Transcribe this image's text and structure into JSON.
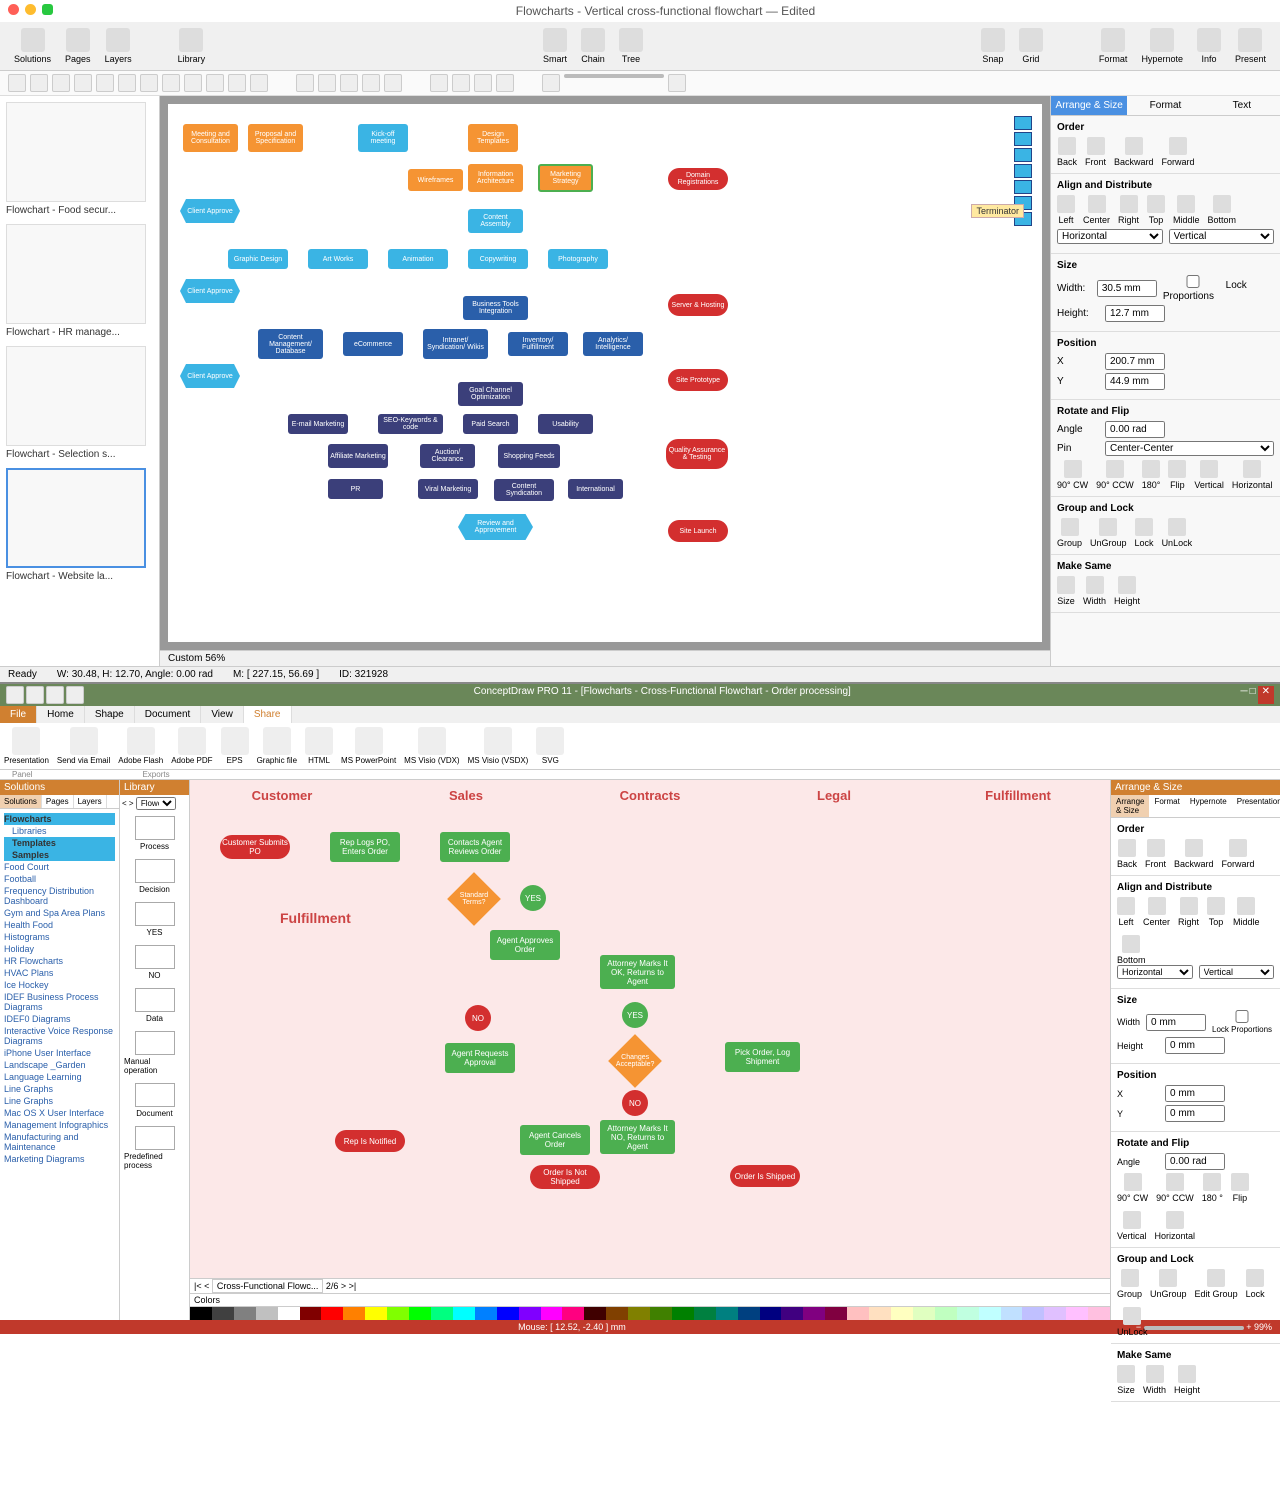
{
  "app1": {
    "title": "Flowcharts - Vertical cross-functional flowchart — Edited",
    "toolbar": {
      "solutions": "Solutions",
      "pages": "Pages",
      "layers": "Layers",
      "library": "Library",
      "smart": "Smart",
      "chain": "Chain",
      "tree": "Tree",
      "snap": "Snap",
      "grid": "Grid",
      "format": "Format",
      "hypernote": "Hypernote",
      "info": "Info",
      "present": "Present"
    },
    "thumbs": [
      {
        "label": "Flowchart - Food secur..."
      },
      {
        "label": "Flowchart - HR manage..."
      },
      {
        "label": "Flowchart - Selection s..."
      },
      {
        "label": "Flowchart - Website la..."
      }
    ],
    "tooltip": "Terminator",
    "zoom": "Custom 56%",
    "statusW": "W: 30.48, H: 12.70, Angle: 0.00 rad",
    "statusM": "M: [ 227.15, 56.69 ]",
    "statusID": "ID: 321928",
    "statusReady": "Ready",
    "shapes": {
      "meeting": "Meeting and Consultation",
      "proposal": "Proposal and Specification",
      "kickoff": "Kick-off meeting",
      "design": "Design Templates",
      "wireframes": "Wireframes",
      "info": "Information Architecture",
      "marketing": "Marketing Strategy",
      "domain": "Domain Registrations",
      "approve": "Client Approve",
      "assembly": "Content Assembly",
      "graphic": "Graphic Design",
      "art": "Art Works",
      "anim": "Animation",
      "copy": "Copywriting",
      "photo": "Photography",
      "btools": "Business Tools Integration",
      "server": "Server & Hosting",
      "cms": "Content Management/ Database",
      "ecom": "eCommerce",
      "intranet": "Intranet/ Syndication/ Wikis",
      "inv": "Inventory/ Fulfillment",
      "analytics": "Analytics/ Intelligence",
      "siteproto": "Site Prototype",
      "goal": "Goal Channel Optimization",
      "email": "E-mail Marketing",
      "seo": "SEO-Keywords & code",
      "paid": "Paid Search",
      "usab": "Usability",
      "aff": "Affiliate Marketing",
      "auction": "Auction/ Clearance",
      "shop": "Shopping Feeds",
      "qa": "Quality Assurance & Testing",
      "pr": "PR",
      "viral": "Viral Marketing",
      "synd": "Content Syndication",
      "intl": "International",
      "review": "Review and Approvement",
      "launch": "Site Launch"
    },
    "inspector": {
      "tabs": {
        "arr": "Arrange & Size",
        "fmt": "Format",
        "txt": "Text"
      },
      "order": {
        "h": "Order",
        "back": "Back",
        "front": "Front",
        "backward": "Backward",
        "forward": "Forward"
      },
      "align": {
        "h": "Align and Distribute",
        "left": "Left",
        "center": "Center",
        "right": "Right",
        "top": "Top",
        "middle": "Middle",
        "bottom": "Bottom",
        "horiz": "Horizontal",
        "vert": "Vertical"
      },
      "size": {
        "h": "Size",
        "wl": "Width:",
        "w": "30.5 mm",
        "hl": "Height:",
        "hv": "12.7 mm",
        "lock": "Lock Proportions"
      },
      "pos": {
        "h": "Position",
        "xl": "X",
        "x": "200.7 mm",
        "yl": "Y",
        "y": "44.9 mm"
      },
      "rot": {
        "h": "Rotate and Flip",
        "al": "Angle",
        "a": "0.00 rad",
        "pl": "Pin",
        "p": "Center-Center",
        "cw": "90° CW",
        "ccw": "90° CCW",
        "d180": "180°",
        "flip": "Flip",
        "v": "Vertical",
        "ho": "Horizontal"
      },
      "grp": {
        "h": "Group and Lock",
        "g": "Group",
        "ug": "UnGroup",
        "l": "Lock",
        "ul": "UnLock"
      },
      "same": {
        "h": "Make Same",
        "s": "Size",
        "w": "Width",
        "ht": "Height"
      }
    }
  },
  "app2": {
    "title": "ConceptDraw PRO 11 - [Flowcharts - Cross-Functional Flowchart - Order processing]",
    "menu": {
      "file": "File",
      "home": "Home",
      "shape": "Shape",
      "document": "Document",
      "view": "View",
      "share": "Share"
    },
    "ribbon": {
      "pres": "Presentation",
      "email": "Send via Email",
      "flash": "Adobe Flash",
      "pdf": "Adobe PDF",
      "eps": "EPS",
      "gfile": "Graphic file",
      "html": "HTML",
      "ppt": "MS PowerPoint",
      "vdx": "MS Visio (VDX)",
      "vsdx": "MS Visio (VSDX)",
      "svg": "SVG",
      "panel": "Panel",
      "exports": "Exports"
    },
    "sol": {
      "h": "Solutions",
      "tabs": {
        "s": "Solutions",
        "p": "Pages",
        "l": "Layers"
      },
      "flowcharts": "Flowcharts",
      "libs": "Libraries",
      "temps": "Templates",
      "samples": "Samples",
      "items": [
        "Food Court",
        "Football",
        "Frequency Distribution Dashboard",
        "Gym and Spa Area Plans",
        "Health Food",
        "Histograms",
        "Holiday",
        "HR Flowcharts",
        "HVAC Plans",
        "Ice Hockey",
        "IDEF Business Process Diagrams",
        "IDEF0 Diagrams",
        "Interactive Voice Response Diagrams",
        "iPhone User Interface",
        "Landscape _Garden",
        "Language Learning",
        "Line Graphs",
        "Line Graphs",
        "Mac OS X User Interface",
        "Management Infographics",
        "Manufacturing and Maintenance",
        "Marketing Diagrams"
      ]
    },
    "lib": {
      "h": "Library",
      "sel": "Flowch...",
      "items": [
        "Process",
        "Decision",
        "YES",
        "NO",
        "Data",
        "Manual operation",
        "Document",
        "Predefined process"
      ]
    },
    "lanes": [
      "Customer",
      "Sales",
      "Contracts",
      "Legal",
      "Fulfillment"
    ],
    "ful": "Fulfillment",
    "shapes": {
      "submit": "Customer Submits PO",
      "rep": "Rep Logs PO, Enters Order",
      "contacts": "Contacts Agent Reviews Order",
      "std": "Standard Terms?",
      "yes": "YES",
      "approve": "Agent Approves Order",
      "att": "Attorney Marks It OK, Returns to Agent",
      "changes": "Changes Acceptable?",
      "pick": "Pick Order, Log Shipment",
      "no": "NO",
      "req": "Agent Requests Approval",
      "attno": "Attorney Marks It NO, Returns to Agent",
      "repnot": "Rep Is Notified",
      "cancel": "Agent Cancels Order",
      "notship": "Order Is Not Shipped",
      "ship": "Order Is Shipped"
    },
    "tabbar": "Cross-Functional Flowc...",
    "colors": "Colors",
    "rp": {
      "h": "Arrange & Size",
      "tabs": {
        "a": "Arrange & Size",
        "f": "Format",
        "h": "Hypernote",
        "p": "Presentation"
      },
      "order": {
        "h": "Order",
        "back": "Back",
        "front": "Front",
        "bw": "Backward",
        "fw": "Forward"
      },
      "align": {
        "h": "Align and Distribute",
        "l": "Left",
        "c": "Center",
        "r": "Right",
        "t": "Top",
        "m": "Middle",
        "b": "Bottom",
        "ho": "Horizontal",
        "v": "Vertical"
      },
      "size": {
        "h": "Size",
        "wl": "Width",
        "w": "0 mm",
        "hl": "Height",
        "hv": "0 mm",
        "lock": "Lock Proportions"
      },
      "pos": {
        "h": "Position",
        "xl": "X",
        "x": "0 mm",
        "yl": "Y",
        "y": "0 mm"
      },
      "rot": {
        "h": "Rotate and Flip",
        "al": "Angle",
        "a": "0.00 rad",
        "cw": "90° CW",
        "ccw": "90° CCW",
        "d": "180 °",
        "f": "Flip",
        "v": "Vertical",
        "ho": "Horizontal"
      },
      "grp": {
        "h": "Group and Lock",
        "g": "Group",
        "ug": "UnGroup",
        "eg": "Edit Group",
        "l": "Lock",
        "ul": "UnLock"
      },
      "same": {
        "h": "Make Same",
        "s": "Size",
        "w": "Width",
        "ht": "Height"
      }
    },
    "status": {
      "mouse": "Mouse: [ 12.52, -2.40 ] mm",
      "zoom": "99%"
    }
  }
}
